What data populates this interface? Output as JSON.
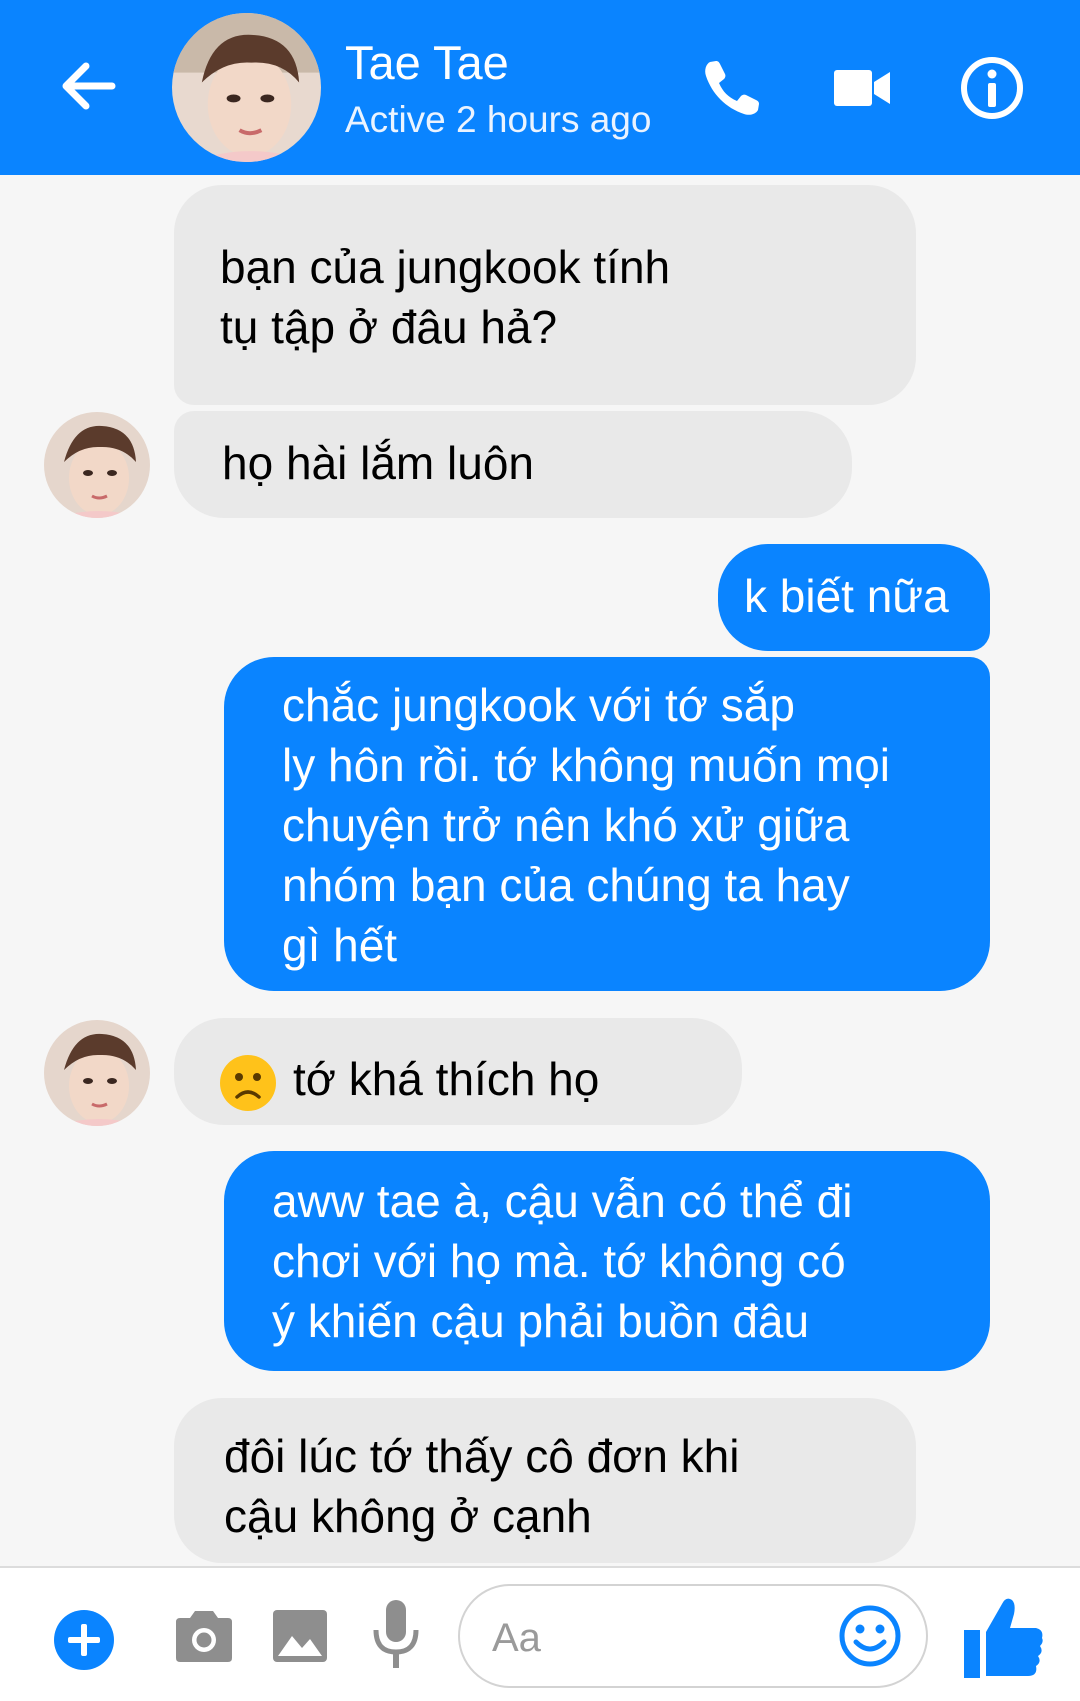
{
  "header": {
    "contact_name": "Tae Tae",
    "status": "Active 2 hours ago",
    "icons": [
      "back-arrow-icon",
      "phone-icon",
      "video-camera-icon",
      "info-icon"
    ]
  },
  "messages": [
    {
      "direction": "incoming",
      "text": "bạn của jungkook tính\ntụ tập ở đâu hả?"
    },
    {
      "direction": "incoming",
      "text": "họ hài lắm luôn"
    },
    {
      "direction": "outgoing",
      "text": "k biết nữa"
    },
    {
      "direction": "outgoing",
      "text": "chắc jungkook với tớ sắp\nly hôn rồi. tớ không muốn mọi\nchuyện trở nên khó xử giữa\nnhóm bạn của chúng ta hay\ngì hết"
    },
    {
      "direction": "incoming",
      "text": "tớ khá thích họ",
      "emoji": "sad-face-emoji"
    },
    {
      "direction": "outgoing",
      "text": "aww tae à, cậu vẫn có thể đi\nchơi với họ mà. tớ không có\ný khiến cậu phải buồn đâu"
    },
    {
      "direction": "incoming",
      "text": "đôi lúc tớ thấy cô đơn khi\ncậu không ở cạnh"
    }
  ],
  "composer": {
    "placeholder": "Aa",
    "icons": [
      "plus-icon",
      "camera-icon",
      "image-icon",
      "microphone-icon",
      "smiley-icon",
      "thumbs-up-icon"
    ]
  },
  "colors": {
    "brand_blue": "#0a84ff",
    "incoming_bubble": "#e9e9e9",
    "background": "#f6f6f6",
    "composer_icon_gray": "#8e8e8e"
  }
}
